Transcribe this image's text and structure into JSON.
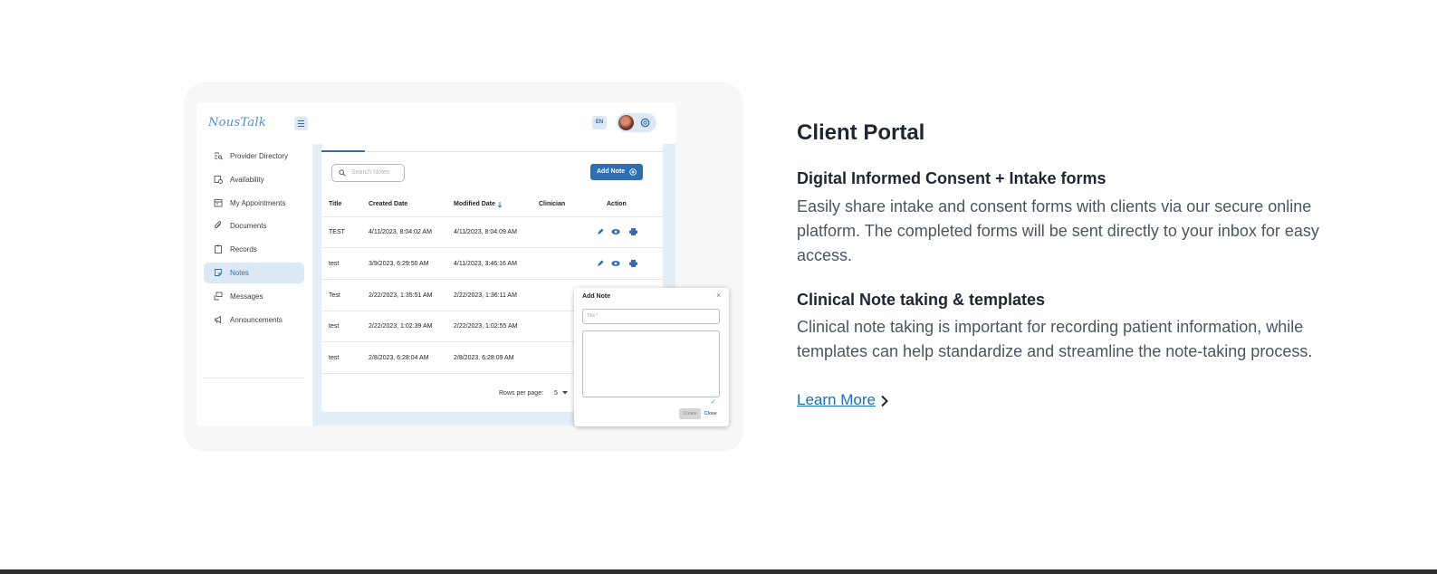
{
  "screenshot": {
    "brand": "NousTalk",
    "header": {
      "language": "EN"
    },
    "sidebar": {
      "items": [
        {
          "label": "Provider Directory",
          "icon": "directory-icon"
        },
        {
          "label": "Availability",
          "icon": "availability-icon"
        },
        {
          "label": "My Appointments",
          "icon": "calendar-icon"
        },
        {
          "label": "Documents",
          "icon": "paperclip-icon"
        },
        {
          "label": "Records",
          "icon": "clipboard-icon"
        },
        {
          "label": "Notes",
          "icon": "note-icon",
          "active": true
        },
        {
          "label": "Messages",
          "icon": "messages-icon"
        },
        {
          "label": "Announcements",
          "icon": "megaphone-icon"
        }
      ]
    },
    "notes": {
      "search_placeholder": "Search Notes",
      "add_button": "Add Note",
      "columns": [
        "Title",
        "Created Date",
        "Modified Date",
        "Clinician",
        "Action"
      ],
      "rows": [
        {
          "title": "TEST",
          "created": "4/11/2023, 8:04:02 AM",
          "modified": "4/11/2023, 8:04:09 AM"
        },
        {
          "title": "test",
          "created": "3/9/2023, 6:29:50 AM",
          "modified": "4/11/2023, 3:46:16 AM"
        },
        {
          "title": "Test",
          "created": "2/22/2023, 1:35:51 AM",
          "modified": "2/22/2023, 1:36:11 AM"
        },
        {
          "title": "test",
          "created": "2/22/2023, 1:02:39 AM",
          "modified": "2/22/2023, 1:02:55 AM"
        },
        {
          "title": "test",
          "created": "2/8/2023, 6:28:04 AM",
          "modified": "2/8/2023, 6:28:09 AM"
        }
      ],
      "rows_per_page_label": "Rows per page:",
      "rows_per_page_value": "5"
    },
    "dialog": {
      "title": "Add Note",
      "title_placeholder": "Title *",
      "create_label": "Create",
      "close_label": "Close"
    }
  },
  "content": {
    "title": "Client Portal",
    "features": [
      {
        "heading": "Digital Informed Consent + Intake forms",
        "body": "Easily share intake and consent forms with clients via our secure online platform. The completed forms will be sent directly to your inbox for easy access."
      },
      {
        "heading": "Clinical Note taking & templates",
        "body": "Clinical note taking is important for recording patient information, while templates can help standardize and streamline the note-taking process."
      }
    ],
    "cta": "Learn More"
  },
  "colors": {
    "accent": "#2f6fb1",
    "link": "#1d6fb8",
    "heading": "#1f2533",
    "body": "#4b5563"
  }
}
